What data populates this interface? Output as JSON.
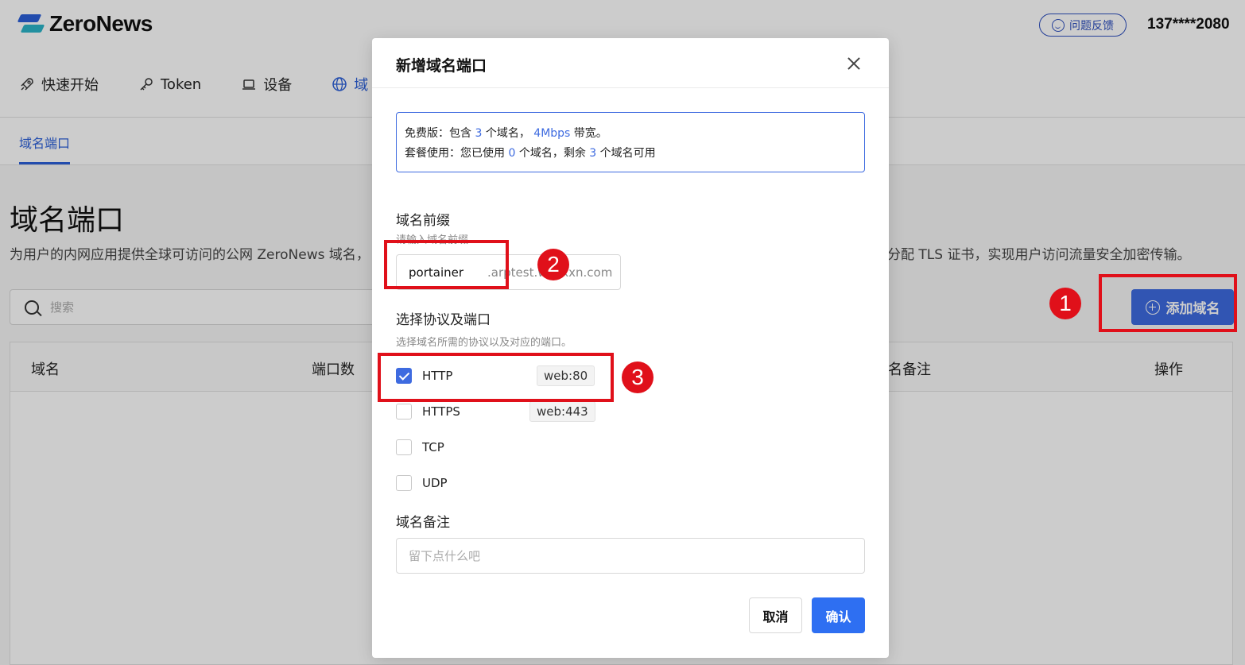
{
  "header": {
    "logo_text": "ZeroNews",
    "feedback_label": "问题反馈",
    "user_phone": "137****2080"
  },
  "nav": {
    "items": [
      {
        "label": "快速开始",
        "icon": "rocket-icon"
      },
      {
        "label": "Token",
        "icon": "key-icon"
      },
      {
        "label": "设备",
        "icon": "laptop-icon"
      },
      {
        "label": "域",
        "icon": "globe-icon"
      }
    ]
  },
  "subtab": {
    "label": "域名端口"
  },
  "main": {
    "title": "域名端口",
    "desc_left": "为用户的内网应用提供全球可访问的公网 ZeroNews 域名，",
    "desc_right": "分配 TLS 证书，实现用户访问流量安全加密传输。",
    "search_placeholder": "搜索",
    "add_button": "添加域名",
    "table_headers": {
      "domain": "域名",
      "port_count": "端口数",
      "remark": "名备注",
      "actions": "操作"
    }
  },
  "modal": {
    "title": "新增域名端口",
    "plan": {
      "line1_a": "免费版：包含 ",
      "line1_count": "3",
      "line1_b": " 个域名，",
      "line1_bw": "4Mbps",
      "line1_c": " 带宽。",
      "line2_a": "套餐使用：您已使用 ",
      "line2_used": "0",
      "line2_b": " 个域名，剩余 ",
      "line2_left": "3",
      "line2_c": " 个域名可用"
    },
    "prefix_label": "域名前缀",
    "prefix_hint": "请输入域名前缀",
    "prefix_value": "portainer",
    "prefix_suffix": ".arptest.wxxxxn.com",
    "protocol_label": "选择协议及端口",
    "protocol_hint": "选择域名所需的协议以及对应的端口。",
    "protocols": [
      {
        "name": "HTTP",
        "checked": true,
        "port": "web:80"
      },
      {
        "name": "HTTPS",
        "checked": false,
        "port": "web:443"
      },
      {
        "name": "TCP",
        "checked": false,
        "port": ""
      },
      {
        "name": "UDP",
        "checked": false,
        "port": ""
      }
    ],
    "remark_label": "域名备注",
    "remark_placeholder": "留下点什么吧",
    "cancel_label": "取消",
    "confirm_label": "确认"
  },
  "annotations": {
    "badge1": "1",
    "badge2": "2",
    "badge3": "3",
    "color": "#e0101a"
  },
  "colors": {
    "primary": "#3e6be0",
    "confirm": "#2e6ff2"
  }
}
